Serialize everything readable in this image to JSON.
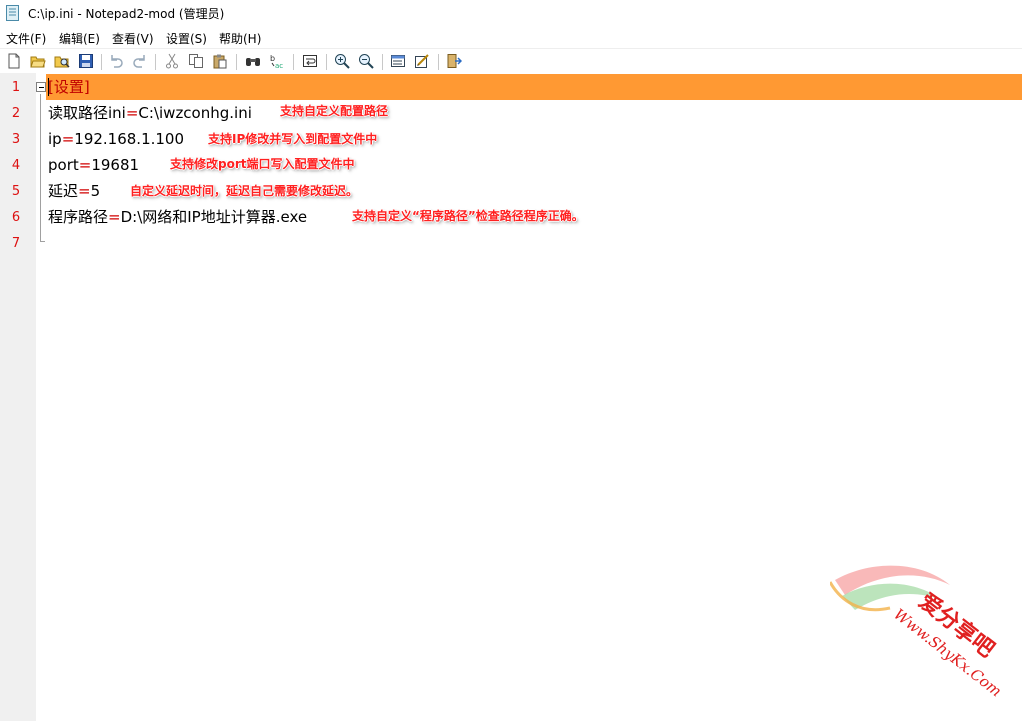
{
  "window": {
    "title": "C:\\ip.ini - Notepad2-mod (管理员)"
  },
  "menu": [
    "文件(F)",
    "编辑(E)",
    "查看(V)",
    "设置(S)",
    "帮助(H)"
  ],
  "toolbar": [
    "new-file-icon",
    "open-file-icon",
    "browse-icon",
    "save-icon",
    "undo-icon",
    "redo-icon",
    "cut-icon",
    "copy-icon",
    "paste-icon",
    "find-icon",
    "replace-icon",
    "word-wrap-icon",
    "zoom-in-icon",
    "zoom-out-icon",
    "scheme-icon",
    "customize-icon",
    "exit-icon"
  ],
  "line_numbers": [
    "1",
    "2",
    "3",
    "4",
    "5",
    "6",
    "7"
  ],
  "editor": {
    "l1": "[设置]",
    "l2_key": "读取路径ini",
    "l2_eq": "=",
    "l2_val": "C:\\iwzconhg.ini",
    "l3_key": "ip",
    "l3_eq": "=",
    "l3_val": "192.168.1.100",
    "l4_key": "port",
    "l4_eq": "=",
    "l4_val": "19681",
    "l5_key": "延迟",
    "l5_eq": "=",
    "l5_val": "5",
    "l6_key": "程序路径",
    "l6_eq": "=",
    "l6_val": "D:\\网络和IP地址计算器.exe"
  },
  "annotations": [
    "支持自定义配置路径",
    "支持IP修改并写入到配置文件中",
    "支持修改port端口写入配置文件中",
    "自定义延迟时间，延迟自己需要修改延迟。",
    "支持自定义“程序路径”检查路径程序正确。"
  ],
  "watermark": {
    "line1": "爱分享吧",
    "line2": "Www.ShyKx.Com"
  },
  "colors": {
    "current_line": "#ff9933",
    "annotation": "#ff2020",
    "line_number": "#d11111"
  }
}
